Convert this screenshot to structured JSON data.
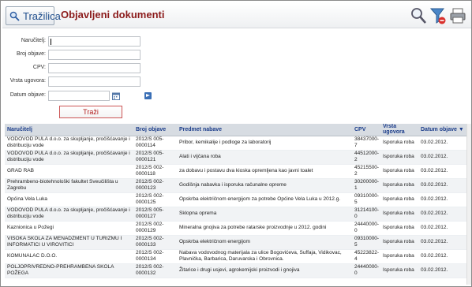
{
  "header": {
    "search_tab_label": "Tražilica",
    "page_title": "Objavljeni dokumenti"
  },
  "form": {
    "fields": [
      {
        "label": "Naručitelj:",
        "value": ""
      },
      {
        "label": "Broj objave:",
        "value": ""
      },
      {
        "label": "CPV:",
        "value": ""
      },
      {
        "label": "Vrsta ugovora:",
        "value": ""
      },
      {
        "label": "Datum objave:",
        "value": ""
      }
    ],
    "submit_label": "Traži"
  },
  "table": {
    "columns": [
      "Naručitelj",
      "Broj objave",
      "Predmet nabave",
      "CPV",
      "Vrsta ugovora",
      "Datum objave ▼"
    ],
    "rows": [
      {
        "a": "VODOVOD PULA d.o.o. za skupljanje, pročišćavanje i distribuciju vode",
        "b": "2012/S 005-0000114",
        "c": "Pribor, kemikalije i podloge za laboratorij",
        "d": "38437000-7",
        "e": "Isporuka roba",
        "f": "03.02.2012."
      },
      {
        "a": "VODOVOD PULA d.o.o. za skupljanje, pročišćavanje i distribuciju vode",
        "b": "2012/S 005-0000121",
        "c": "Alati i vijčana roba",
        "d": "44512000-2",
        "e": "Isporuka roba",
        "f": "03.02.2012."
      },
      {
        "a": "GRAD RAB",
        "b": "2012/S 002-0000118",
        "c": "za dobavu i postavu dva kioska opremljena kao javni toalet",
        "d": "45215500-2",
        "e": "Isporuka roba",
        "f": "03.02.2012."
      },
      {
        "a": "Prehrambeno-biotehnološki fakultet Sveučilišta u Zagrebu",
        "b": "2012/S 002-0000123",
        "c": "Godišnja nabavka i isporuka računalne opreme",
        "d": "30200000-1",
        "e": "Isporuka roba",
        "f": "03.02.2012."
      },
      {
        "a": "Općina Vela Luka",
        "b": "2012/S 002-0000125",
        "c": "Opskrba električnom energijom za potrebe Općine Vela Luka u 2012.g.",
        "d": "09310000-5",
        "e": "Isporuka roba",
        "f": "03.02.2012."
      },
      {
        "a": "VODOVOD PULA d.o.o. za skupljanje, pročišćavanje i distribuciju vode",
        "b": "2012/S 005-0000127",
        "c": "Sklopna oprema",
        "d": "31214100-0",
        "e": "Isporuka roba",
        "f": "03.02.2012."
      },
      {
        "a": "Kaznionica u Požegi",
        "b": "2012/S 002-0000129",
        "c": "Mineralna gnojiva za potrebe ratarske proizvodnje u 2012. godini",
        "d": "24440000-0",
        "e": "Isporuka roba",
        "f": "03.02.2012."
      },
      {
        "a": "VISOKA ŠKOLA ZA MENADŽMENT U TURIZMU I INFORMATICI U VIROVITICI",
        "b": "2012/S 002-0000133",
        "c": "Opskrba električnom energijom",
        "d": "09310000-5",
        "e": "Isporuka roba",
        "f": "03.02.2012."
      },
      {
        "a": "KOMUNALAC D.O.O.",
        "b": "2012/S 002-0000134",
        "c": "Nabava vodovodnog materijala za ulice Bogovićeva, Šuffaja, Vidikovac, Plavnička, Barbarica, Daruvarska i Obrovnica.",
        "d": "45223822-4",
        "e": "Isporuka roba",
        "f": "03.02.2012."
      },
      {
        "a": "POLJOPRIVREDNO-PREHRAMBENA ŠKOLA POŽEGA",
        "b": "2012/S 002-0000132",
        "c": "Žitarice i drugi usjevi, agrokemijski proizvodi i gnojiva",
        "d": "24440000-0",
        "e": "Isporuka roba",
        "f": "03.02.2012."
      }
    ]
  },
  "icons": {
    "search": "magnifier-icon",
    "filter_clear": "filter-clear-icon",
    "print": "print-icon"
  }
}
